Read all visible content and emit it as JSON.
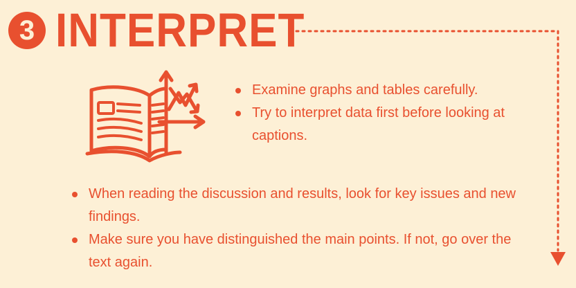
{
  "step": {
    "number": "3",
    "title": "INTERPRET"
  },
  "illustration": {
    "icon": "book-with-chart-icon"
  },
  "top_bullets": [
    "Examine graphs and tables carefully.",
    "Try to interpret data first before looking at captions."
  ],
  "bottom_bullets": [
    "When reading the discussion and results, look for key issues and new findings.",
    "Make sure you have distinguished the main points. If not, go over the text again."
  ],
  "colors": {
    "accent": "#e8502f",
    "background": "#fdf0d6"
  }
}
